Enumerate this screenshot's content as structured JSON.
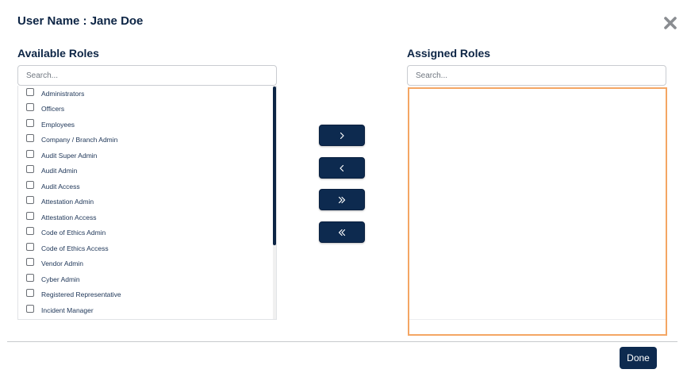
{
  "header": {
    "title": "User Name : Jane Doe"
  },
  "available": {
    "label": "Available Roles",
    "search_placeholder": "Search...",
    "items": [
      {
        "label": "Administrators",
        "checked": false
      },
      {
        "label": "Officers",
        "checked": false
      },
      {
        "label": "Employees",
        "checked": false
      },
      {
        "label": "Company / Branch Admin",
        "checked": false
      },
      {
        "label": "Audit Super Admin",
        "checked": false
      },
      {
        "label": "Audit Admin",
        "checked": false
      },
      {
        "label": "Audit Access",
        "checked": false
      },
      {
        "label": "Attestation Admin",
        "checked": false
      },
      {
        "label": "Attestation Access",
        "checked": false
      },
      {
        "label": "Code of Ethics Admin",
        "checked": false
      },
      {
        "label": "Code of Ethics Access",
        "checked": false
      },
      {
        "label": "Vendor Admin",
        "checked": false
      },
      {
        "label": "Cyber Admin",
        "checked": false
      },
      {
        "label": "Registered Representative",
        "checked": false
      },
      {
        "label": "Incident Manager",
        "checked": false
      }
    ]
  },
  "assigned": {
    "label": "Assigned Roles",
    "search_placeholder": "Search...",
    "items": []
  },
  "controls": {
    "move_right_label": ">",
    "move_left_label": "<",
    "move_all_right_label": ">>",
    "move_all_left_label": "<<"
  },
  "footer": {
    "done_label": "Done"
  },
  "colors": {
    "primary": "#0d2a4f",
    "assigned_border": "#f4a664"
  }
}
